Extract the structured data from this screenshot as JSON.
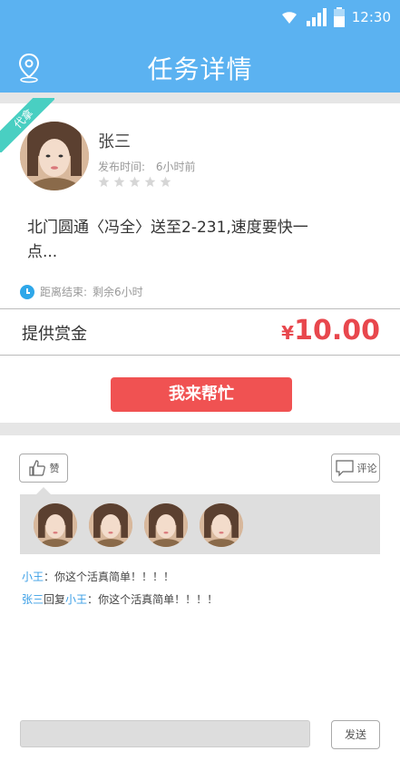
{
  "status_bar": {
    "time": "12:30"
  },
  "header": {
    "title": "任务详情",
    "location_icon": "location-pin-icon"
  },
  "task": {
    "badge": "代拿",
    "user_name": "张三",
    "publish_label": "发布时间:",
    "publish_time": "6小时前",
    "rating": 0,
    "rating_max": 5,
    "description": "北门圆通〈冯全〉送至2-231,速度要快一点...",
    "deadline_label": "距离结束:",
    "deadline_value": "剩余6小时",
    "reward_label": "提供赏金",
    "reward_currency": "¥",
    "reward_value": "10.00",
    "help_button": "我来帮忙"
  },
  "social": {
    "like_label": "赞",
    "comment_label": "评论",
    "likers_count": 4,
    "comments": [
      {
        "user": "小王",
        "sep": "：",
        "text": "你这个活真简单！！！！"
      },
      {
        "user": "张三",
        "reply_word": "回复",
        "reply_to": "小王",
        "sep": "：",
        "text": "你这个活真简单！！！！"
      }
    ]
  },
  "footer": {
    "input_placeholder": "",
    "send_label": "发送"
  },
  "colors": {
    "header": "#5bb2f1",
    "accent_red": "#f05252",
    "ribbon": "#49cfc2",
    "link_blue": "#3a9ee6"
  }
}
